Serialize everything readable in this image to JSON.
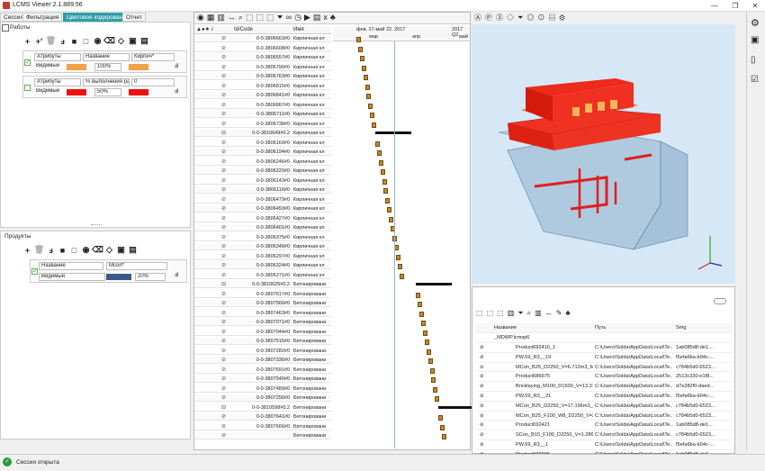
{
  "window": {
    "title": "LCMS Viewer 2.1.889.56",
    "min": "—",
    "max": "❐",
    "close": "✕"
  },
  "tabs": [
    {
      "label": "Сессия"
    },
    {
      "label": "Фильтрация"
    },
    {
      "label": "Цветовое кодирование",
      "active": true
    },
    {
      "label": "Отчет"
    }
  ],
  "works": {
    "title": "Работы",
    "rule1": {
      "field1": "Атрибуты",
      "field2": "Название",
      "field3": "Кирпич*",
      "visibility": "Видимый",
      "opacity": "100%",
      "color1": "#f5a04a",
      "color2": "#f5a04a"
    },
    "rule2": {
      "field1": "Атрибуты",
      "field2": "% выполнения раб",
      "field3": "0",
      "visibility": "Видимый",
      "opacity": "50%",
      "color1": "#ee1111",
      "color2": "#ee1111"
    }
  },
  "products": {
    "title": "Продукты",
    "rule1": {
      "field1": "Название",
      "field2": "Mcon*",
      "visibility": "Видимый",
      "opacity": "20%",
      "color": "#3a5a8a"
    }
  },
  "gantt": {
    "col_id": "Id/Code",
    "col_name": "Имя",
    "timeline_top": "фев. 17-май 22, 2017",
    "timeline_right": "2017 Q2",
    "months": [
      "мар",
      "апр",
      "май"
    ],
    "rows": [
      {
        "id": "0-0-3806663#0",
        "name": "Кирпичная кл"
      },
      {
        "id": "0-0-3806608#0",
        "name": "Кирпичная кл"
      },
      {
        "id": "0-0-3806557#0",
        "name": "Кирпичная кл"
      },
      {
        "id": "0-0-3806790#0",
        "name": "Кирпичная кл"
      },
      {
        "id": "0-0-3806763#0",
        "name": "Кирпичная кл"
      },
      {
        "id": "0-0-3806815#0",
        "name": "Кирпичная кл"
      },
      {
        "id": "0-0-3806841#0",
        "name": "Кирпичная кл"
      },
      {
        "id": "0-0-3806867#0",
        "name": "Кирпичная кл"
      },
      {
        "id": "0-0-3806711#0",
        "name": "Кирпичная кл"
      },
      {
        "id": "0-0-3806738#0",
        "name": "Кирпичная кл"
      },
      {
        "id": "0-0-3810649#0.2",
        "name": "Кирпичная кл",
        "group": true
      },
      {
        "id": "0-0-3806169#0",
        "name": "Кирпичная кл"
      },
      {
        "id": "0-0-3806194#0",
        "name": "Кирпичная кл"
      },
      {
        "id": "0-0-3806246#0",
        "name": "Кирпичная кл"
      },
      {
        "id": "0-0-3806220#0",
        "name": "Кирпичная кл"
      },
      {
        "id": "0-0-3806143#0",
        "name": "Кирпичная кл"
      },
      {
        "id": "0-0-3806116#0",
        "name": "Кирпичная кл"
      },
      {
        "id": "0-0-3806479#0",
        "name": "Кирпичная кл"
      },
      {
        "id": "0-0-3806453#0",
        "name": "Кирпичная кл"
      },
      {
        "id": "0-0-3806427#0",
        "name": "Кирпичная кл"
      },
      {
        "id": "0-0-3806401#0",
        "name": "Кирпичная кл"
      },
      {
        "id": "0-0-3806375#0",
        "name": "Кирпичная кл"
      },
      {
        "id": "0-0-3806349#0",
        "name": "Кирпичная кл"
      },
      {
        "id": "0-0-3806297#0",
        "name": "Кирпичная кл"
      },
      {
        "id": "0-0-3806324#0",
        "name": "Кирпичная кл"
      },
      {
        "id": "0-0-3806271#0",
        "name": "Кирпичная кл"
      },
      {
        "id": "0-0-3810625#0.2",
        "name": "Бетонировани",
        "group": true
      },
      {
        "id": "0-0-3807617#0",
        "name": "Бетонировани"
      },
      {
        "id": "0-0-3807566#0",
        "name": "Бетонировани"
      },
      {
        "id": "0-0-3807463#0",
        "name": "Бетонировани"
      },
      {
        "id": "0-0-3807071#0",
        "name": "Бетонировани"
      },
      {
        "id": "0-0-3807044#0",
        "name": "Бетонировани"
      },
      {
        "id": "0-0-3807515#0",
        "name": "Бетонировани"
      },
      {
        "id": "0-0-3807282#0",
        "name": "Бетонировани"
      },
      {
        "id": "0-0-3807336#0",
        "name": "Бетонировани"
      },
      {
        "id": "0-0-3807691#0",
        "name": "Бетонировани"
      },
      {
        "id": "0-0-3807540#0",
        "name": "Бетонировани"
      },
      {
        "id": "0-0-3807489#0",
        "name": "Бетонировани"
      },
      {
        "id": "0-0-3807256#0",
        "name": "Бетонировани"
      },
      {
        "id": "0-0-3810598#0.2",
        "name": "Бетонировани",
        "group": true
      },
      {
        "id": "0-0-3807641#0",
        "name": "Бетонировани"
      },
      {
        "id": "0-0-3807666#0",
        "name": "Бетонировани"
      },
      {
        "id": "",
        "name": "Бетонировани"
      }
    ]
  },
  "products_table": {
    "col_name": "Название",
    "col_path": "Путь",
    "col_smg": "Smg",
    "root": "_MDWP.lcmsp6",
    "rows": [
      {
        "name": "Product692416_1",
        "path": "C:\\Users\\Solda\\AppData\\Local\\Te...",
        "smg": "1ab085d8-de1..."
      },
      {
        "name": "PW.59_R3__19",
        "path": "C:\\Users\\Solda\\AppData\\Local\\Te...",
        "smg": "f5efa6ba-b04c-..."
      },
      {
        "name": "MCon_B25_D2250_V=6.712m3_M...",
        "path": "C:\\Users\\Solda\\AppData\\Local\\Te...",
        "smg": "c784b5d0-6523..."
      },
      {
        "name": "Product686675",
        "path": "C:\\Users\\Solda\\AppData\\Local\\Te...",
        "smg": "2513c330-e1f8..."
      },
      {
        "name": "Bricklaying_M100_D1500_V=13.37...",
        "path": "C:\\Users\\Solda\\AppData\\Local\\Te...",
        "smg": "d7e282f0-daed..."
      },
      {
        "name": "PW.59_R3__21",
        "path": "C:\\Users\\Solda\\AppData\\Local\\Te...",
        "smg": "f5efa6ba-b04c-..."
      },
      {
        "name": "MCon_B25_D2250_V=17.196m3_...",
        "path": "C:\\Users\\Solda\\AppData\\Local\\Te...",
        "smg": "c784b5d0-6523..."
      },
      {
        "name": "MCon_B25_F100_W8_D2250_V=2...",
        "path": "C:\\Users\\Solda\\AppData\\Local\\Te...",
        "smg": "c784b5d0-6523..."
      },
      {
        "name": "Product692421",
        "path": "C:\\Users\\Solda\\AppData\\Local\\Te...",
        "smg": "1ab085d8-de1..."
      },
      {
        "name": "SCon_B15_F100_D2250_V=1.286m...",
        "path": "C:\\Users\\Solda\\AppData\\Local\\Te...",
        "smg": "c784b5d0-6523..."
      },
      {
        "name": "PW.69_R3__1",
        "path": "C:\\Users\\Solda\\AppData\\Local\\Te...",
        "smg": "f5efa6ba-b04c-..."
      },
      {
        "name": "Product692005",
        "path": "C:\\Users\\Solda\\AppData\\Local\\Te...",
        "smg": "1ab085d8-de1..."
      }
    ]
  },
  "status": {
    "text": "Сессия открыта"
  },
  "colors": {
    "accent": "#2f9ea5",
    "gantt_bar": "#c8892a",
    "view_bg": "#d6e8f6",
    "brick_red": "#e8281c"
  }
}
